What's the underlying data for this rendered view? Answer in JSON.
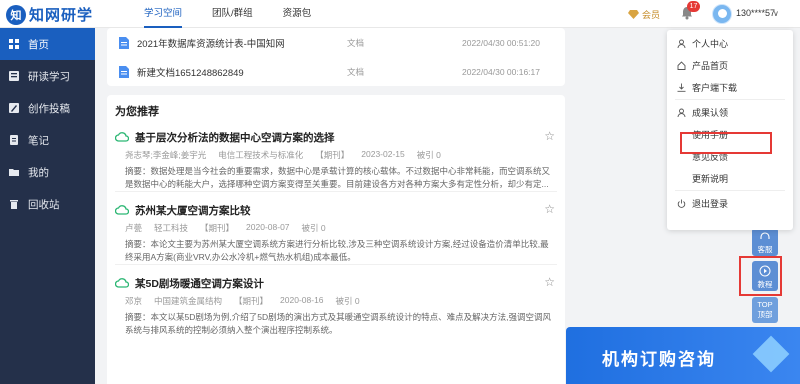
{
  "logo": {
    "mark": "知",
    "text": "知网研学"
  },
  "topnav": {
    "tabs": [
      "学习空间",
      "团队/群组",
      "资源包"
    ],
    "active": 0
  },
  "header": {
    "member_label": "会员",
    "notification_count": "17",
    "username": "130****57",
    "caret": "∨"
  },
  "sidebar": {
    "items": [
      {
        "label": "首页",
        "icon": "home-icon"
      },
      {
        "label": "研读学习",
        "icon": "book-icon"
      },
      {
        "label": "创作投稿",
        "icon": "edit-icon"
      },
      {
        "label": "笔记",
        "icon": "note-icon"
      },
      {
        "label": "我的",
        "icon": "folder-icon"
      },
      {
        "label": "回收站",
        "icon": "trash-icon"
      }
    ]
  },
  "files": [
    {
      "name": "2021年数据库资源统计表-中国知网",
      "type": "文档",
      "date": "2022/04/30 00:51:20"
    },
    {
      "name": "新建文档1651248862849",
      "type": "文档",
      "date": "2022/04/30 00:16:17"
    }
  ],
  "recommend": {
    "title": "为您推荐",
    "items": [
      {
        "title": "基于层次分析法的数据中心空调方案的选择",
        "authors": "尧志琴;李金峰;姜宇光",
        "source": "电信工程技术与标准化",
        "kind": "【期刊】",
        "date": "2023-02-15",
        "cited": "被引 0",
        "abstract": "摘要：数据处理是当今社会的重要需求，数据中心是承载计算的核心载体。不过数据中心非常耗能，而空调系统又是数据中心的耗能大户，选择哪种空调方案变得至关重要。目前建设各方对各种方案大多有定性分析，却少有定..."
      },
      {
        "title": "苏州某大厦空调方案比较",
        "authors": "卢甍",
        "source": "轻工科技",
        "kind": "【期刊】",
        "date": "2020-08-07",
        "cited": "被引 0",
        "abstract": "摘要：本论文主要为苏州某大厦空调系统方案进行分析比较,涉及三种空调系统设计方案,经过设备造价清单比较,最终采用A方案(商业VRV,办公水冷机+燃气热水机组)成本最低。"
      },
      {
        "title": "某5D剧场暖通空调方案设计",
        "authors": "邓京",
        "source": "中国建筑金属结构",
        "kind": "【期刊】",
        "date": "2020-08-16",
        "cited": "被引 0",
        "abstract": "摘要：本文以某5D剧场为例,介绍了5D剧场的演出方式及其暖通空调系统设计的特点、难点及解决方法,强调空调风系统与排风系统的控制必须纳入整个演出程序控制系统。"
      }
    ]
  },
  "dropdown": {
    "items": [
      {
        "label": "个人中心",
        "icon": "user-icon"
      },
      {
        "label": "产品首页",
        "icon": "home-icon"
      },
      {
        "label": "客户端下载",
        "icon": "download-icon"
      },
      {
        "label": "成果认领",
        "icon": "user-check-icon"
      },
      {
        "label": "使用手册",
        "icon": ""
      },
      {
        "label": "意见反馈",
        "icon": ""
      },
      {
        "label": "更新说明",
        "icon": ""
      },
      {
        "label": "退出登录",
        "icon": "power-icon"
      }
    ]
  },
  "float": {
    "service": "客服",
    "tutorial": "教程",
    "top_en": "TOP",
    "top_cn": "顶部"
  },
  "banner": {
    "text": "机构订购咨询"
  },
  "colors": {
    "primary": "#1a5fbf",
    "sidebar": "#24304a",
    "highlight": "#e53935"
  }
}
